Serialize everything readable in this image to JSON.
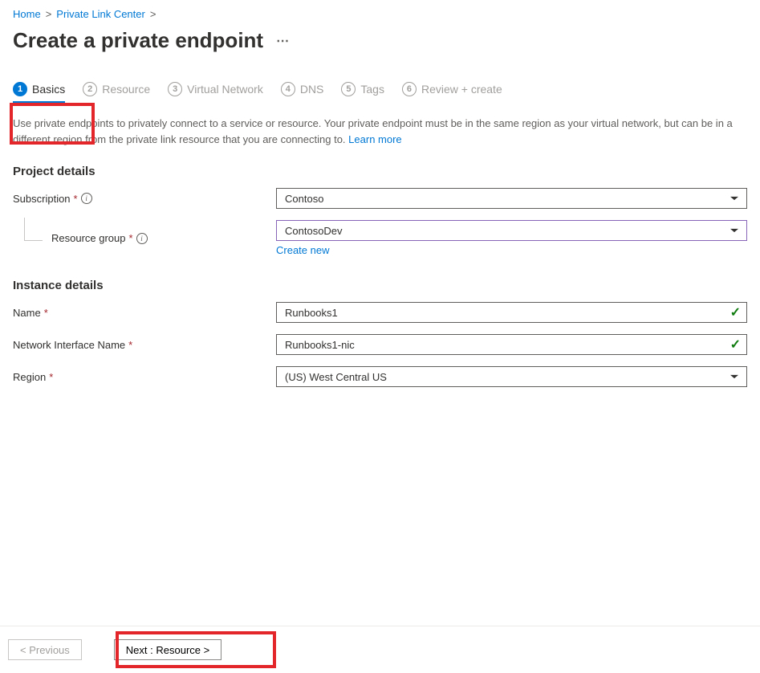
{
  "breadcrumb": {
    "items": [
      "Home",
      "Private Link Center"
    ]
  },
  "page": {
    "title": "Create a private endpoint",
    "description": "Use private endpoints to privately connect to a service or resource. Your private endpoint must be in the same region as your virtual network, but can be in a different region from the private link resource that you are connecting to.  ",
    "learn_more": "Learn more"
  },
  "tabs": {
    "items": [
      {
        "num": "1",
        "label": "Basics",
        "active": true
      },
      {
        "num": "2",
        "label": "Resource",
        "active": false
      },
      {
        "num": "3",
        "label": "Virtual Network",
        "active": false
      },
      {
        "num": "4",
        "label": "DNS",
        "active": false
      },
      {
        "num": "5",
        "label": "Tags",
        "active": false
      },
      {
        "num": "6",
        "label": "Review + create",
        "active": false
      }
    ]
  },
  "sections": {
    "project": "Project details",
    "instance": "Instance details"
  },
  "form": {
    "subscription": {
      "label": "Subscription",
      "value": "Contoso"
    },
    "resource_group": {
      "label": "Resource group",
      "value": "ContosoDev",
      "create_new": "Create new"
    },
    "name": {
      "label": "Name",
      "value": "Runbooks1"
    },
    "nic": {
      "label": "Network Interface Name",
      "value": "Runbooks1-nic"
    },
    "region": {
      "label": "Region",
      "value": "(US) West Central US"
    }
  },
  "footer": {
    "prev": "< Previous",
    "next": "Next : Resource >"
  }
}
